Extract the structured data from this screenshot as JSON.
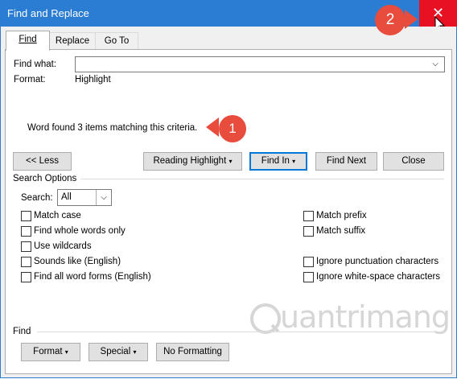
{
  "window": {
    "title": "Find and Replace",
    "close_glyph": "✕"
  },
  "tabs": [
    {
      "label": "Find",
      "active": true
    },
    {
      "label": "Replace",
      "active": false
    },
    {
      "label": "Go To",
      "active": false
    }
  ],
  "find": {
    "find_what_label": "Find what:",
    "find_what_value": "",
    "format_label": "Format:",
    "format_value": "Highlight",
    "status_message": "Word found 3 items matching this criteria."
  },
  "buttons": {
    "less": "<< Less",
    "reading_highlight": "Reading Highlight",
    "find_in": "Find In",
    "find_next": "Find Next",
    "close": "Close"
  },
  "search_options": {
    "heading": "Search Options",
    "search_label": "Search:",
    "search_value": "All",
    "left": [
      "Match case",
      "Find whole words only",
      "Use wildcards",
      "Sounds like (English)",
      "Find all word forms (English)"
    ],
    "right": [
      "Match prefix",
      "Match suffix",
      "Ignore punctuation characters",
      "Ignore white-space characters"
    ]
  },
  "find_section": {
    "heading": "Find",
    "format_btn": "Format",
    "special_btn": "Special",
    "no_formatting_btn": "No Formatting"
  },
  "annotations": {
    "badge1": "1",
    "badge2": "2",
    "color": "#e74c3c"
  },
  "watermark": "uantrimang"
}
